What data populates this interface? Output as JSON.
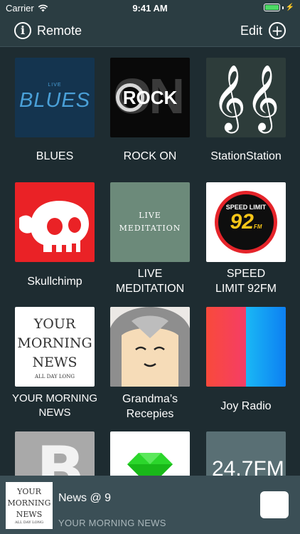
{
  "status_bar": {
    "carrier": "Carrier",
    "time": "9:41 AM"
  },
  "nav": {
    "title": "Remote",
    "edit_label": "Edit",
    "info_icon": "ⓘ",
    "add_icon": "+"
  },
  "stations": [
    {
      "name": "BLUES",
      "art": {
        "small": "LIVE",
        "big": "BLUES"
      }
    },
    {
      "name": "ROCK ON",
      "art": {
        "big": "ON",
        "overlay": "ROCK"
      }
    },
    {
      "name": "StationStation",
      "art": {
        "glyph": "𝄞𝄞"
      }
    },
    {
      "name": "Skullchimp",
      "art": {}
    },
    {
      "name_line1": "LIVE",
      "name_line2": "MEDITATION",
      "art": {
        "line1": "LIVE",
        "line2": "MEDITATION"
      }
    },
    {
      "name_line1": "SPEED",
      "name_line2": "LIMIT 92FM",
      "art": {
        "top": "SPEED LIMIT",
        "num": "92",
        "unit": "FM"
      }
    },
    {
      "name_line1": "YOUR MORNING",
      "name_line2": "NEWS",
      "art": {
        "line1": "YOUR",
        "line2": "MORNING",
        "line3": "NEWS",
        "sub": "ALL DAY LONG"
      }
    },
    {
      "name_line1": "Grandma’s",
      "name_line2": "Recepies",
      "art": {}
    },
    {
      "name": "Joy Radio",
      "art": {}
    },
    {
      "art": {
        "letter": "B"
      }
    },
    {
      "art": {}
    },
    {
      "art": {
        "freq": "24.7FM"
      }
    }
  ],
  "now_playing": {
    "title": "News @ 9",
    "subtitle": "YOUR MORNING NEWS",
    "art": {
      "line1": "YOUR",
      "line2": "MORNING",
      "line3": "NEWS",
      "sub": "ALL DAY LONG"
    }
  },
  "colors": {
    "background": "#1e2c31",
    "nav": "#2b3d42",
    "now_playing": "#3b4f56",
    "battery": "#4cd964"
  }
}
